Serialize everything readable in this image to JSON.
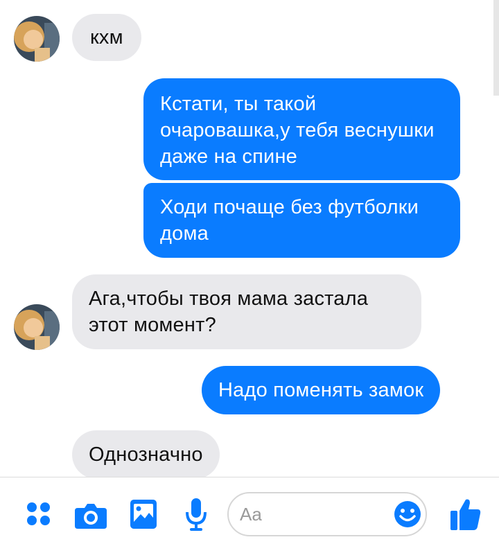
{
  "messages": [
    {
      "from": "them",
      "text": "кхм"
    },
    {
      "from": "me",
      "text": "Кстати, ты такой очаровашка,у тебя веснушки даже на спине"
    },
    {
      "from": "me",
      "text": "Ходи почаще без футболки дома"
    },
    {
      "from": "them",
      "text": "Ага,чтобы твоя мама застала этот момент?"
    },
    {
      "from": "me",
      "text": "Надо поменять замок"
    },
    {
      "from": "them",
      "text": "Однозначно"
    }
  ],
  "composer": {
    "placeholder": "Aa",
    "icons": [
      "more-icon",
      "camera-icon",
      "gallery-icon",
      "microphone-icon",
      "emoji-icon",
      "thumbs-up-icon"
    ]
  },
  "colors": {
    "outgoing": "#0a7cff",
    "incoming": "#e9e9ec",
    "accent": "#0a7cff"
  }
}
